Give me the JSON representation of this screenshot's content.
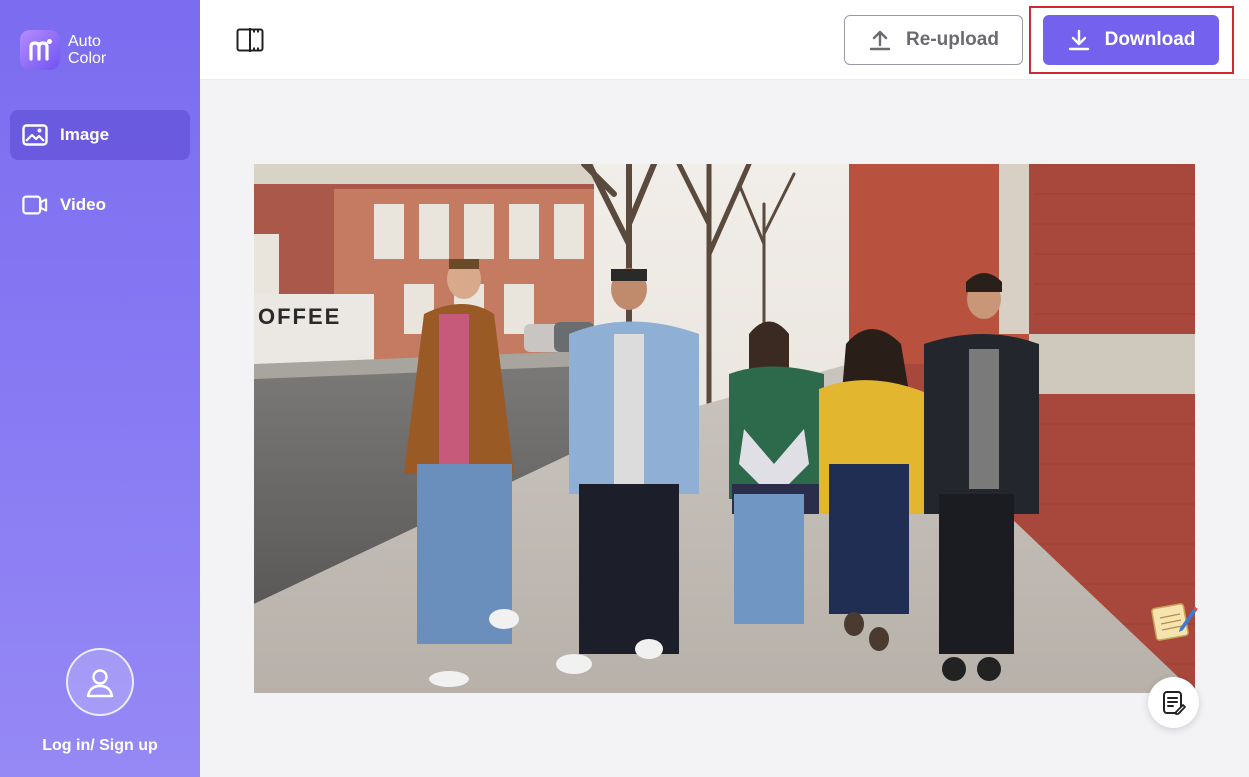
{
  "brand": {
    "line1": "Auto",
    "line2": "Color"
  },
  "sidebar": {
    "items": [
      {
        "label": "Image",
        "icon": "image-icon",
        "active": true
      },
      {
        "label": "Video",
        "icon": "video-icon",
        "active": false
      }
    ],
    "login_label": "Log in/ Sign up"
  },
  "toolbar": {
    "reupload_label": "Re-upload",
    "download_label": "Download"
  },
  "preview": {
    "building_sign": "OFFEE"
  },
  "colors": {
    "accent": "#7462ee",
    "sidebar": "#8a7cf3",
    "highlight": "#d3262f"
  }
}
